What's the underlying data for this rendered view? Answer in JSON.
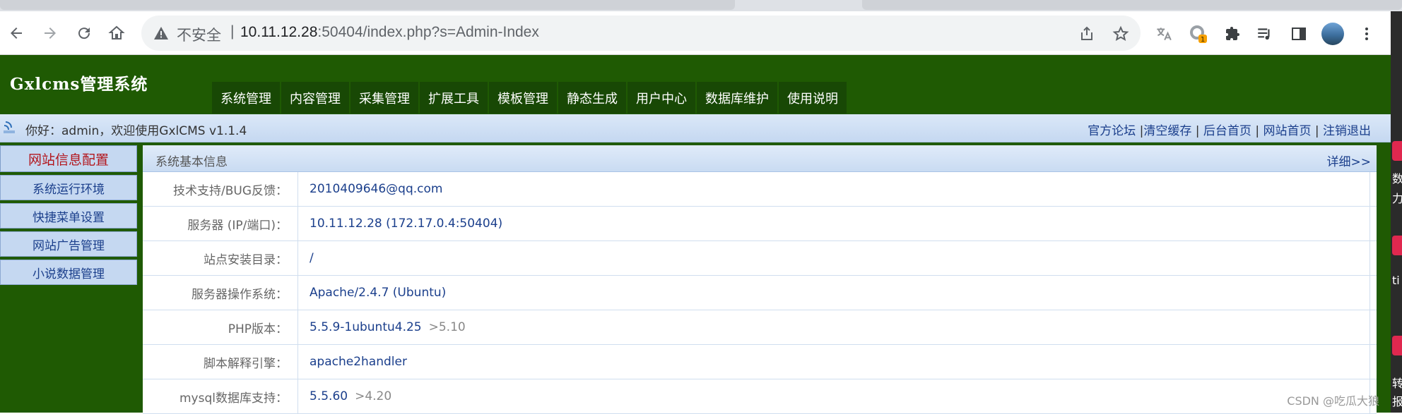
{
  "browser": {
    "omnibox": {
      "security_label": "不安全",
      "separator": "|",
      "url_host": "10.11.12.28",
      "url_rest": ":50404/index.php?s=Admin-Index"
    },
    "extension_badge": "1"
  },
  "app": {
    "brand": "Gxlcms管理系统",
    "nav": [
      "系统管理",
      "内容管理",
      "采集管理",
      "扩展工具",
      "模板管理",
      "静态生成",
      "用户中心",
      "数据库维护",
      "使用说明"
    ],
    "welcome": "你好：admin，欢迎使用GxlCMS v1.1.4",
    "top_links": [
      "官方论坛",
      "清空缓存",
      "后台首页",
      "网站首页",
      "注销退出"
    ],
    "top_link_sep": "|"
  },
  "sidebar": {
    "header": "网站信息配置",
    "items": [
      "系统运行环境",
      "快捷菜单设置",
      "网站广告管理",
      "小说数据管理"
    ]
  },
  "content": {
    "title": "系统基本信息",
    "detail_link": "详细>>",
    "rows": [
      {
        "label": "技术支持/BUG反馈：",
        "value": "2010409646@qq.com",
        "note": ""
      },
      {
        "label": "服务器 (IP/端口)：",
        "value": "10.11.12.28 (172.17.0.4:50404)",
        "note": ""
      },
      {
        "label": "站点安装目录：",
        "value": "/",
        "note": ""
      },
      {
        "label": "服务器操作系统：",
        "value": "Apache/2.4.7 (Ubuntu)",
        "note": ""
      },
      {
        "label": "PHP版本：",
        "value": "5.5.9-1ubuntu4.25",
        "note": ">5.10"
      },
      {
        "label": "脚本解释引擎：",
        "value": "apache2handler",
        "note": ""
      },
      {
        "label": "mysql数据库支持：",
        "value": "5.5.60",
        "note": ">4.20"
      }
    ]
  },
  "watermark": "CSDN @吃瓜大狼",
  "right_window": {
    "fragments": [
      "数",
      "力",
      "ti",
      "转",
      "报"
    ]
  },
  "colors": {
    "page_green": "#1f5a03",
    "nav_item": "#184805",
    "link_blue": "#1b3f8c",
    "sidebar_header_text": "#b3161d",
    "panel_blue": "#c5d8f1"
  }
}
